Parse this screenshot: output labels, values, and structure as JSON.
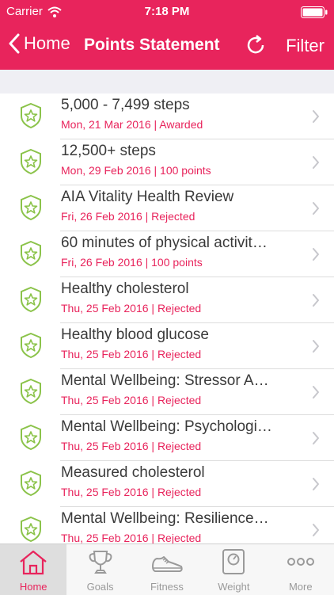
{
  "status": {
    "carrier": "Carrier",
    "time": "7:18 PM"
  },
  "nav": {
    "back_label": "Home",
    "title": "Points Statement",
    "filter_label": "Filter"
  },
  "colors": {
    "accent": "#e8245c",
    "shield": "#8bc34a"
  },
  "items": [
    {
      "name": "5,000 - 7,499 steps",
      "sub": "Mon, 21 Mar 2016 | Awarded"
    },
    {
      "name": "12,500+ steps",
      "sub": "Mon, 29 Feb 2016 | 100 points"
    },
    {
      "name": "AIA Vitality Health Review",
      "sub": "Fri, 26 Feb 2016 | Rejected"
    },
    {
      "name": "60 minutes of physical activit…",
      "sub": "Fri, 26 Feb 2016 | 100 points"
    },
    {
      "name": "Healthy cholesterol",
      "sub": "Thu, 25 Feb 2016 | Rejected"
    },
    {
      "name": "Healthy blood glucose",
      "sub": "Thu, 25 Feb 2016 | Rejected"
    },
    {
      "name": "Mental Wellbeing: Stressor A…",
      "sub": "Thu, 25 Feb 2016 | Rejected"
    },
    {
      "name": "Mental Wellbeing: Psychologi…",
      "sub": "Thu, 25 Feb 2016 | Rejected"
    },
    {
      "name": "Measured cholesterol",
      "sub": "Thu, 25 Feb 2016 | Rejected"
    },
    {
      "name": "Mental Wellbeing: Resilience…",
      "sub": "Thu, 25 Feb 2016 | Rejected"
    }
  ],
  "tabs": [
    {
      "label": "Home",
      "icon": "home-icon",
      "active": true
    },
    {
      "label": "Goals",
      "icon": "trophy-icon",
      "active": false
    },
    {
      "label": "Fitness",
      "icon": "shoe-icon",
      "active": false
    },
    {
      "label": "Weight",
      "icon": "scale-icon",
      "active": false
    },
    {
      "label": "More",
      "icon": "more-dots-icon",
      "active": false
    }
  ]
}
